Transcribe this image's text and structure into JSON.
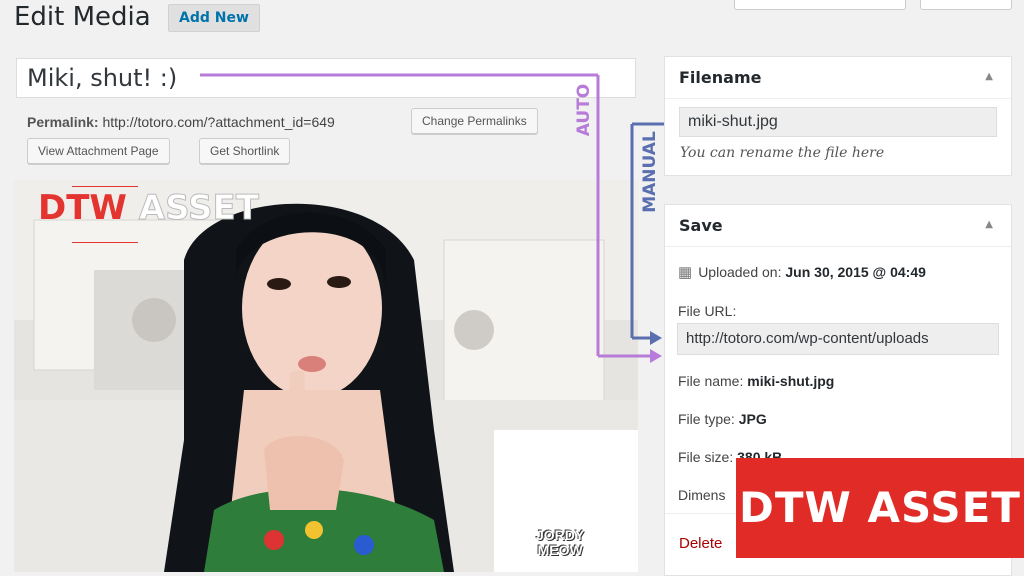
{
  "header": {
    "title": "Edit Media",
    "add_new": "Add New"
  },
  "media": {
    "title": "Miki, shut! :)",
    "permalink_label": "Permalink:",
    "permalink_url": "http://totoro.com/?attachment_id=649",
    "change_permalinks": "Change Permalinks",
    "view_attachment": "View Attachment Page",
    "get_shortlink": "Get Shortlink",
    "photo_credit_line1": "JORDY",
    "photo_credit_line2": "MEOW"
  },
  "annotations": {
    "auto": "AUTO",
    "manual": "MANUAL",
    "auto_color": "#b77bd9",
    "manual_color": "#5a6fb0"
  },
  "filename_panel": {
    "title": "Filename",
    "value": "miki-shut.jpg",
    "hint": "You can rename the file here"
  },
  "save_panel": {
    "title": "Save",
    "uploaded_label": "Uploaded on:",
    "uploaded_value": "Jun 30, 2015 @ 04:49",
    "file_url_label": "File URL:",
    "file_url_value": "http://totoro.com/wp-content/uploads",
    "file_name_label": "File name:",
    "file_name_value": "miki-shut.jpg",
    "file_type_label": "File type:",
    "file_type_value": "JPG",
    "file_size_label": "File size:",
    "file_size_value": "380 kB",
    "dimensions_label": "Dimens",
    "delete_label": "Delete"
  },
  "watermark": {
    "logo_part1": "DTW",
    "logo_part2": "ASSET",
    "badge_text": "DTW ASSET",
    "brand_color": "#e02b27"
  }
}
